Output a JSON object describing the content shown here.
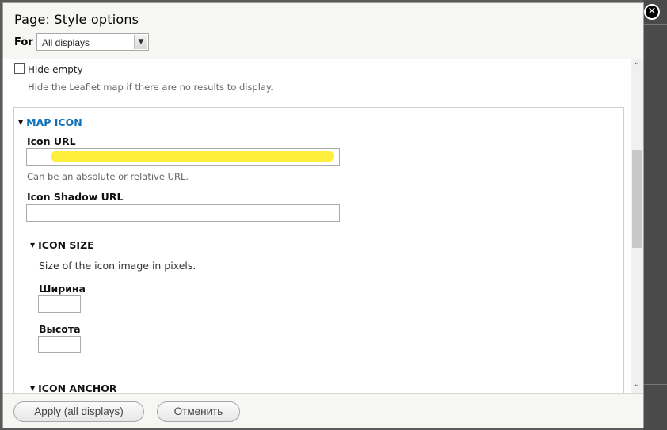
{
  "dialog": {
    "title": "Page: Style options",
    "for_label": "For",
    "display_select": {
      "selected": "All displays"
    }
  },
  "hide_empty": {
    "label": "Hide empty",
    "checked": false,
    "description": "Hide the Leaflet map if there are no results to display."
  },
  "map_icon": {
    "legend": "MAP ICON",
    "icon_url": {
      "label": "Icon URL",
      "value": "",
      "description": "Can be an absolute or relative URL."
    },
    "icon_shadow_url": {
      "label": "Icon Shadow URL",
      "value": ""
    },
    "icon_size": {
      "legend": "ICON SIZE",
      "description": "Size of the icon image in pixels.",
      "width_label": "Ширина",
      "height_label": "Высота"
    },
    "icon_anchor": {
      "legend": "ICON ANCHOR"
    }
  },
  "footer": {
    "apply_label": "Apply (all displays)",
    "cancel_label": "Отменить"
  },
  "icons": {
    "close": "close-icon",
    "select_arrow": "chevron-down-icon",
    "collapse": "triangle-down-icon",
    "scroll_up": "scroll-up-icon",
    "scroll_down": "scroll-down-icon"
  },
  "colors": {
    "legend_link": "#0d6fb8",
    "highlight": "#ffee33",
    "dialog_chrome": "#f6f6f2"
  }
}
